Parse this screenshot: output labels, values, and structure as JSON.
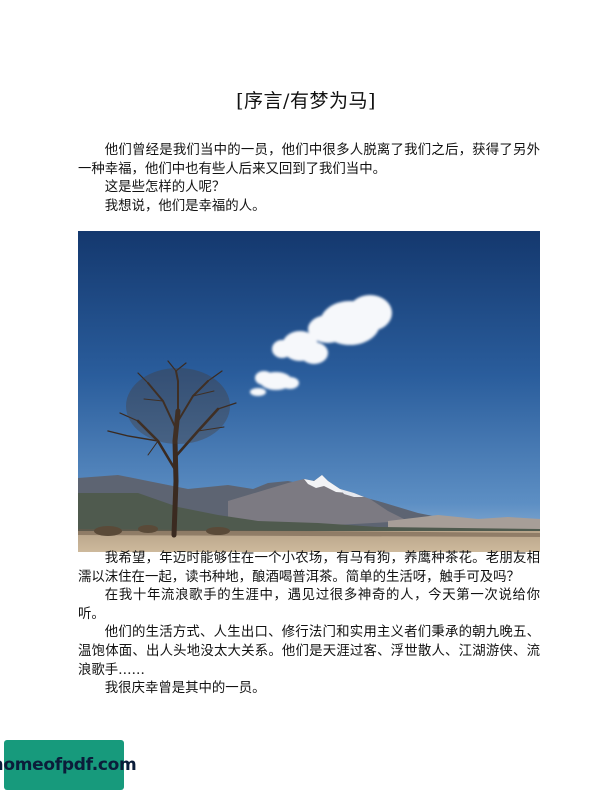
{
  "document": {
    "title": "[序言/有梦为马]",
    "intro": [
      "他们曾经是我们当中的一员，他们中很多人脱离了我们之后，获得了另外一种幸福，他们中也有些人后来又回到了我们当中。",
      "这是些怎样的人呢？",
      "我想说，他们是幸福的人。"
    ],
    "body": [
      "我希望，年迈时能够住在一个小农场，有马有狗，养鹰种茶花。老朋友相濡以沫住在一起，读书种地，酿酒喝普洱茶。简单的生活呀，触手可及吗？",
      "在我十年流浪歌手的生涯中，遇见过很多神奇的人，今天第一次说给你听。",
      "他们的生活方式、人生出口、修行法门和实用主义者们秉承的朝九晚五、温饱体面、出人头地没太大关系。他们是天涯过客、浮世散人、江湖游侠、流浪歌手……",
      "我很庆幸曾是其中的一员。"
    ]
  },
  "watermark": {
    "text": "homeofpdf.com",
    "color": "#179a7c"
  },
  "photo": {
    "subject": "blue sky with clouds, a lone bare tree and snow-capped mountains"
  }
}
